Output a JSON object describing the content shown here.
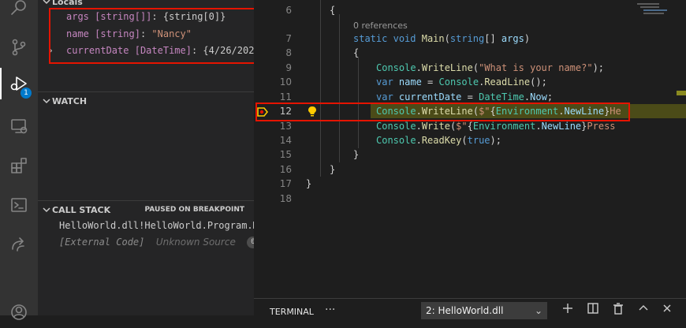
{
  "sidebar": {
    "locals_title": "Locals",
    "locals": [
      {
        "name": "args",
        "type": "[string[]]",
        "sep": ": ",
        "value": "{string[0]}"
      },
      {
        "name": "name",
        "type": "[string]",
        "sep": ": ",
        "value": "\"Nancy\""
      },
      {
        "name": "currentDate",
        "type": "[DateTime]",
        "sep": ": ",
        "value": "{4/26/202..."
      }
    ],
    "watch_title": "WATCH",
    "callstack_title": "CALL STACK",
    "callstack_status": "PAUSED ON BREAKPOINT",
    "callstack": [
      {
        "frame": "HelloWorld.dll!HelloWorld.Program.Ma"
      },
      {
        "frame": "[External Code]",
        "source": "Unknown Source",
        "count": "0"
      }
    ]
  },
  "activity": {
    "debug_badge": "1",
    "icons": [
      "search-icon",
      "source-control-icon",
      "debug-icon",
      "remote-explorer-icon",
      "extensions-icon",
      "terminal-icon",
      "live-share-icon",
      "account-icon"
    ]
  },
  "editor": {
    "references": "0 references",
    "lines": [
      {
        "n": "6",
        "text": "{"
      },
      {
        "n": "7",
        "text": "static void Main(string[] args)"
      },
      {
        "n": "8",
        "text": "{"
      },
      {
        "n": "9",
        "text": "Console.WriteLine(\"What is your name?\");"
      },
      {
        "n": "10",
        "text": "var name = Console.ReadLine();"
      },
      {
        "n": "11",
        "text": "var currentDate = DateTime.Now;"
      },
      {
        "n": "12",
        "text": "Console.WriteLine($\"{Environment.NewLine}He"
      },
      {
        "n": "13",
        "text": "Console.Write($\"{Environment.NewLine}Press"
      },
      {
        "n": "14",
        "text": "Console.ReadKey(true);"
      },
      {
        "n": "15",
        "text": "}"
      },
      {
        "n": "16",
        "text": "}"
      },
      {
        "n": "17",
        "text": "}"
      },
      {
        "n": "18",
        "text": ""
      }
    ],
    "current_line": "12"
  },
  "panel": {
    "tab": "TERMINAL",
    "more": "···",
    "terminal_select": "2: HelloWorld.dll"
  },
  "colors": {
    "highlight_box": "#e51400",
    "current_line_bg": "#4b4b18",
    "accent": "#007acc"
  }
}
